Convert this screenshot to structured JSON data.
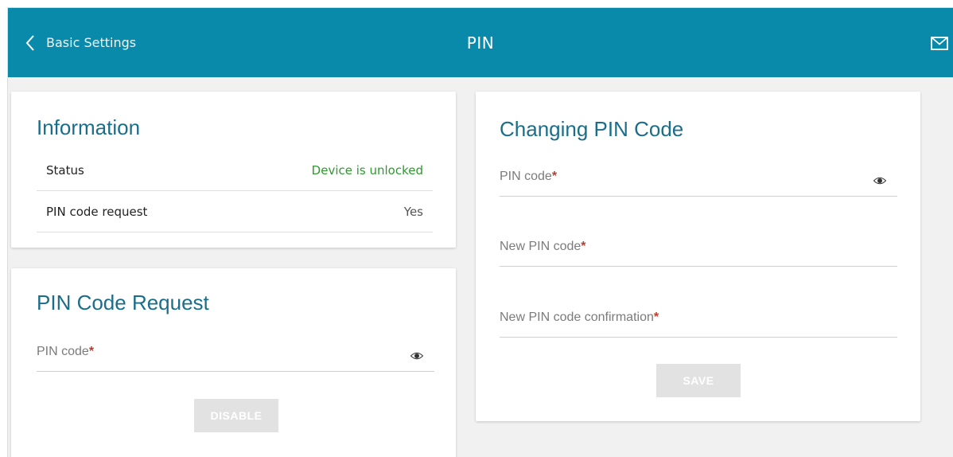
{
  "header": {
    "back_label": "Basic Settings",
    "title": "PIN",
    "mail_icon": "envelope-icon"
  },
  "information": {
    "title": "Information",
    "rows": [
      {
        "label": "Status",
        "value": "Device is unlocked",
        "value_color": "#2c9a2c"
      },
      {
        "label": "PIN code request",
        "value": "Yes"
      }
    ]
  },
  "pin_request": {
    "title": "PIN Code Request",
    "pin_field": {
      "label": "PIN code",
      "required_mark": "*",
      "value": ""
    },
    "button_label": "DISABLE"
  },
  "change_pin": {
    "title": "Changing PIN Code",
    "fields": [
      {
        "label": "PIN code",
        "required_mark": "*",
        "value": ""
      },
      {
        "label": "New PIN code",
        "required_mark": "*",
        "value": ""
      },
      {
        "label": "New PIN code confirmation",
        "required_mark": "*",
        "value": ""
      }
    ],
    "button_label": "SAVE"
  },
  "colors": {
    "header_bg": "#0a8aab",
    "card_title": "#1b6e8a",
    "status_ok": "#2c9a2c",
    "required": "#c0392b",
    "button_disabled": "#e2e2e2"
  }
}
